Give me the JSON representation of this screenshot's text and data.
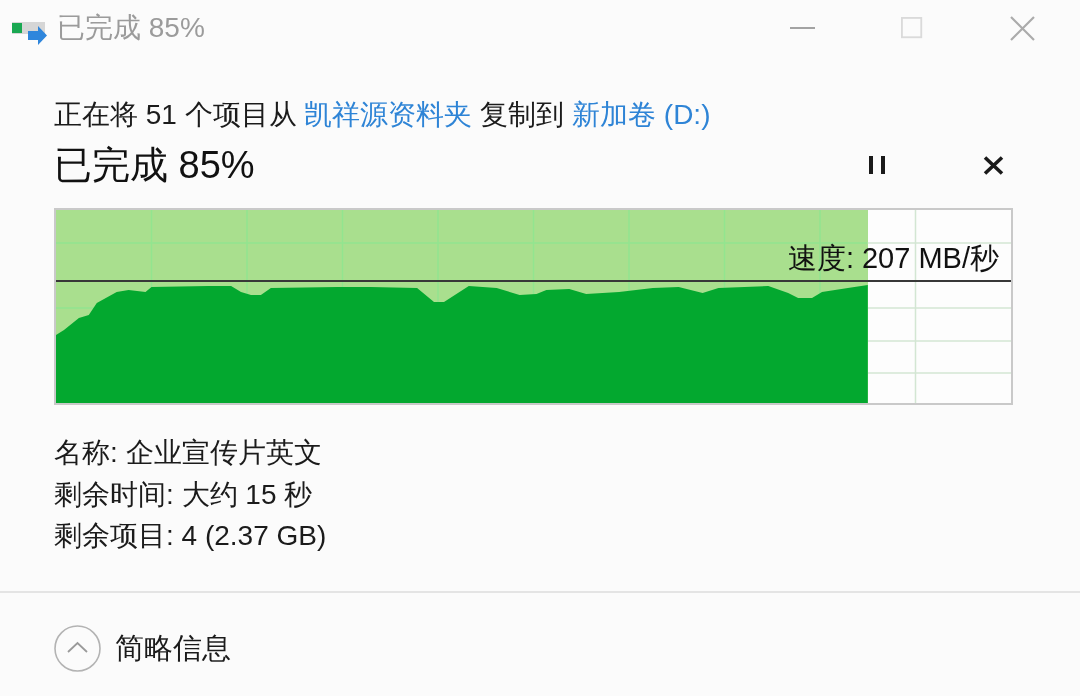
{
  "window": {
    "title": "已完成 85%",
    "maximize_disabled": true
  },
  "description": [
    {
      "kind": "text",
      "text": "正在将 51 个项目从"
    },
    {
      "kind": "link",
      "text": "凯祥源资料夹"
    },
    {
      "kind": "text",
      "text": "复制到"
    },
    {
      "kind": "link",
      "text": "新加卷 (D:)"
    }
  ],
  "progress": {
    "heading": "已完成 85%",
    "level": 0.85,
    "speed": "速度: 207 MB/秒"
  },
  "details": [
    "名称: 企业宣传片英文",
    "剩余时间: 大约 15 秒",
    "剩余项目: 4 (2.37 GB)"
  ],
  "footer": {
    "label": "简略信息",
    "expanded": true
  }
}
